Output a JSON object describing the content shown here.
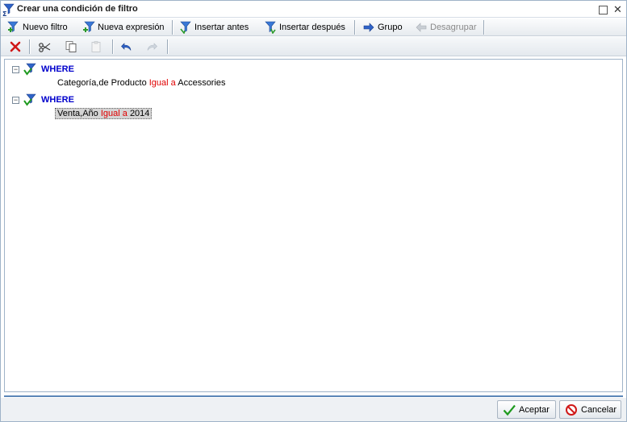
{
  "window": {
    "title": "Crear una condición de filtro"
  },
  "toolbar1": {
    "new_filter": "Nuevo filtro",
    "new_expression": "Nueva expresión",
    "insert_before": "Insertar antes",
    "insert_after": "Insertar después",
    "group": "Grupo",
    "ungroup": "Desagrupar"
  },
  "tree": {
    "nodes": [
      {
        "keyword": "WHERE",
        "field": "Categoría,de Producto",
        "operator": "Igual a",
        "value": "Accessories"
      },
      {
        "keyword": "WHERE",
        "field": "Venta,Año",
        "operator": "Igual a",
        "value": "2014"
      }
    ]
  },
  "footer": {
    "accept": "Aceptar",
    "cancel": "Cancelar"
  },
  "colors": {
    "keyword": "#0000cc",
    "operator": "#e00000",
    "accent": "#5b87b8"
  }
}
